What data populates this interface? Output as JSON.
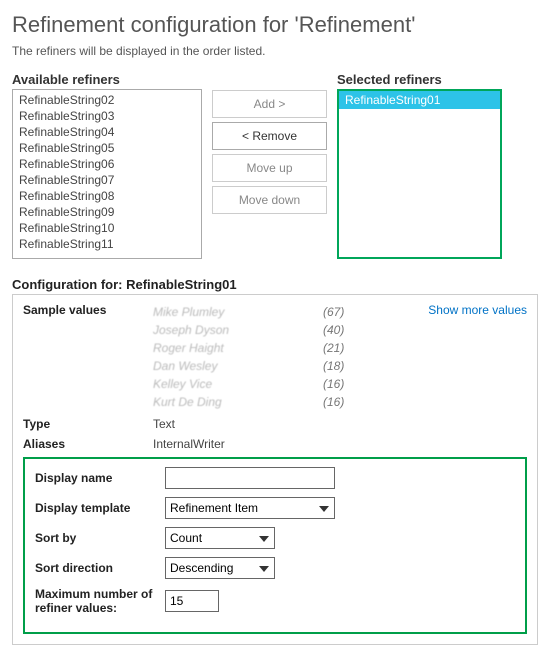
{
  "title": "Refinement configuration for 'Refinement'",
  "subtext": "The refiners will be displayed in the order listed.",
  "available_label": "Available refiners",
  "selected_label": "Selected refiners",
  "available": [
    "RefinableString02",
    "RefinableString03",
    "RefinableString04",
    "RefinableString05",
    "RefinableString06",
    "RefinableString07",
    "RefinableString08",
    "RefinableString09",
    "RefinableString10",
    "RefinableString11"
  ],
  "selected": [
    "RefinableString01"
  ],
  "buttons": {
    "add": "Add >",
    "remove": "< Remove",
    "moveup": "Move up",
    "movedown": "Move down"
  },
  "config_for_label": "Configuration for: RefinableString01",
  "sample_label": "Sample values",
  "samples": [
    {
      "name": "Mike Plumley",
      "count": "(67)"
    },
    {
      "name": "Joseph Dyson",
      "count": "(40)"
    },
    {
      "name": "Roger Haight",
      "count": "(21)"
    },
    {
      "name": "Dan Wesley",
      "count": "(18)"
    },
    {
      "name": "Kelley Vice",
      "count": "(16)"
    },
    {
      "name": "Kurt De Ding",
      "count": "(16)"
    }
  ],
  "show_more": "Show more values",
  "type_label": "Type",
  "type_value": "Text",
  "aliases_label": "Aliases",
  "aliases_value": "InternalWriter",
  "form": {
    "display_name_label": "Display name",
    "display_name_value": "",
    "display_template_label": "Display template",
    "display_template_value": "Refinement Item",
    "sort_by_label": "Sort by",
    "sort_by_value": "Count",
    "sort_dir_label": "Sort direction",
    "sort_dir_value": "Descending",
    "max_label": "Maximum number of refiner values:",
    "max_value": "15"
  }
}
